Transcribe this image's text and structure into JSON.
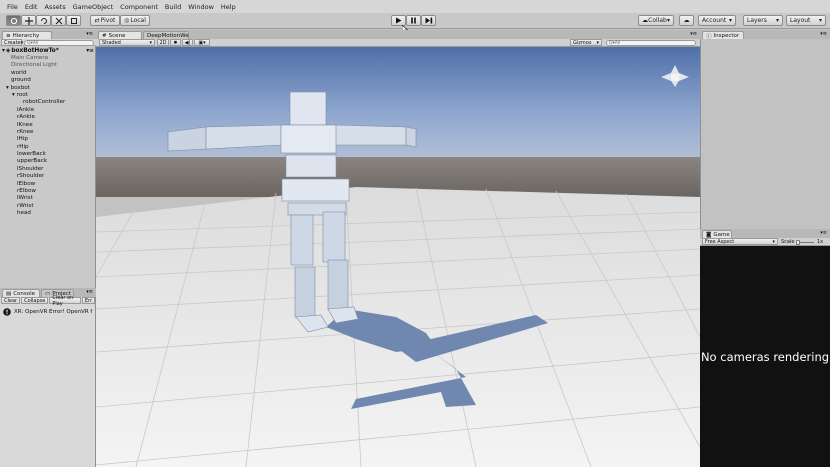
{
  "menu": [
    "File",
    "Edit",
    "Assets",
    "GameObject",
    "Component",
    "Build",
    "Window",
    "Help"
  ],
  "toolbar": {
    "pivot_label": "Pivot",
    "local_label": "Local",
    "collab_label": "Collab",
    "account_label": "Account",
    "layers_label": "Layers",
    "layout_label": "Layout"
  },
  "hierarchy": {
    "tab_label": "Hierarchy",
    "create_label": "Create",
    "search_placeholder": "Q▾All",
    "scene_name": "boxBotHowTo*",
    "items": [
      {
        "label": "Main Camera",
        "indent": 1,
        "muted": true
      },
      {
        "label": "Directional Light",
        "indent": 1,
        "muted": true
      },
      {
        "label": "world",
        "indent": 1,
        "muted": false
      },
      {
        "label": "ground",
        "indent": 1,
        "muted": false
      },
      {
        "label": "boxbot",
        "indent": 1,
        "muted": false,
        "arrow": true
      },
      {
        "label": "root",
        "indent": 2,
        "muted": false,
        "arrow": true
      },
      {
        "label": "robotController",
        "indent": 3,
        "muted": false
      },
      {
        "label": "lAnkle",
        "indent": 2,
        "muted": false
      },
      {
        "label": "rAnkle",
        "indent": 2,
        "muted": false
      },
      {
        "label": "lKnee",
        "indent": 2,
        "muted": false
      },
      {
        "label": "rKnee",
        "indent": 2,
        "muted": false
      },
      {
        "label": "lHip",
        "indent": 2,
        "muted": false
      },
      {
        "label": "rHip",
        "indent": 2,
        "muted": false
      },
      {
        "label": "lowerBack",
        "indent": 2,
        "muted": false
      },
      {
        "label": "upperBack",
        "indent": 2,
        "muted": false
      },
      {
        "label": "lShoulder",
        "indent": 2,
        "muted": false
      },
      {
        "label": "rShoulder",
        "indent": 2,
        "muted": false
      },
      {
        "label": "lElbow",
        "indent": 2,
        "muted": false
      },
      {
        "label": "rElbow",
        "indent": 2,
        "muted": false
      },
      {
        "label": "lWrist",
        "indent": 2,
        "muted": false
      },
      {
        "label": "rWrist",
        "indent": 2,
        "muted": false
      },
      {
        "label": "head",
        "indent": 2,
        "muted": false
      }
    ]
  },
  "console": {
    "tab_console": "Console",
    "tab_project": "Project",
    "clear_label": "Clear",
    "collapse_label": "Collapse",
    "clear_on_play_label": "Clear on Play",
    "error_pause_label": "Err",
    "message": "XR: OpenVR Error! OpenVR f"
  },
  "scene": {
    "tab_scene": "Scene",
    "tab_deepmotion": "DeepMotionWe",
    "shaded_label": "Shaded",
    "mode_2d_label": "2D",
    "gizmos_label": "Gizmos",
    "search_placeholder": "Q▾All"
  },
  "inspector": {
    "tab_label": "Inspector"
  },
  "game": {
    "tab_label": "Game",
    "aspect_label": "Free Aspect",
    "scale_label": "Scale",
    "scale_value": "1x",
    "message": "No cameras rendering"
  }
}
